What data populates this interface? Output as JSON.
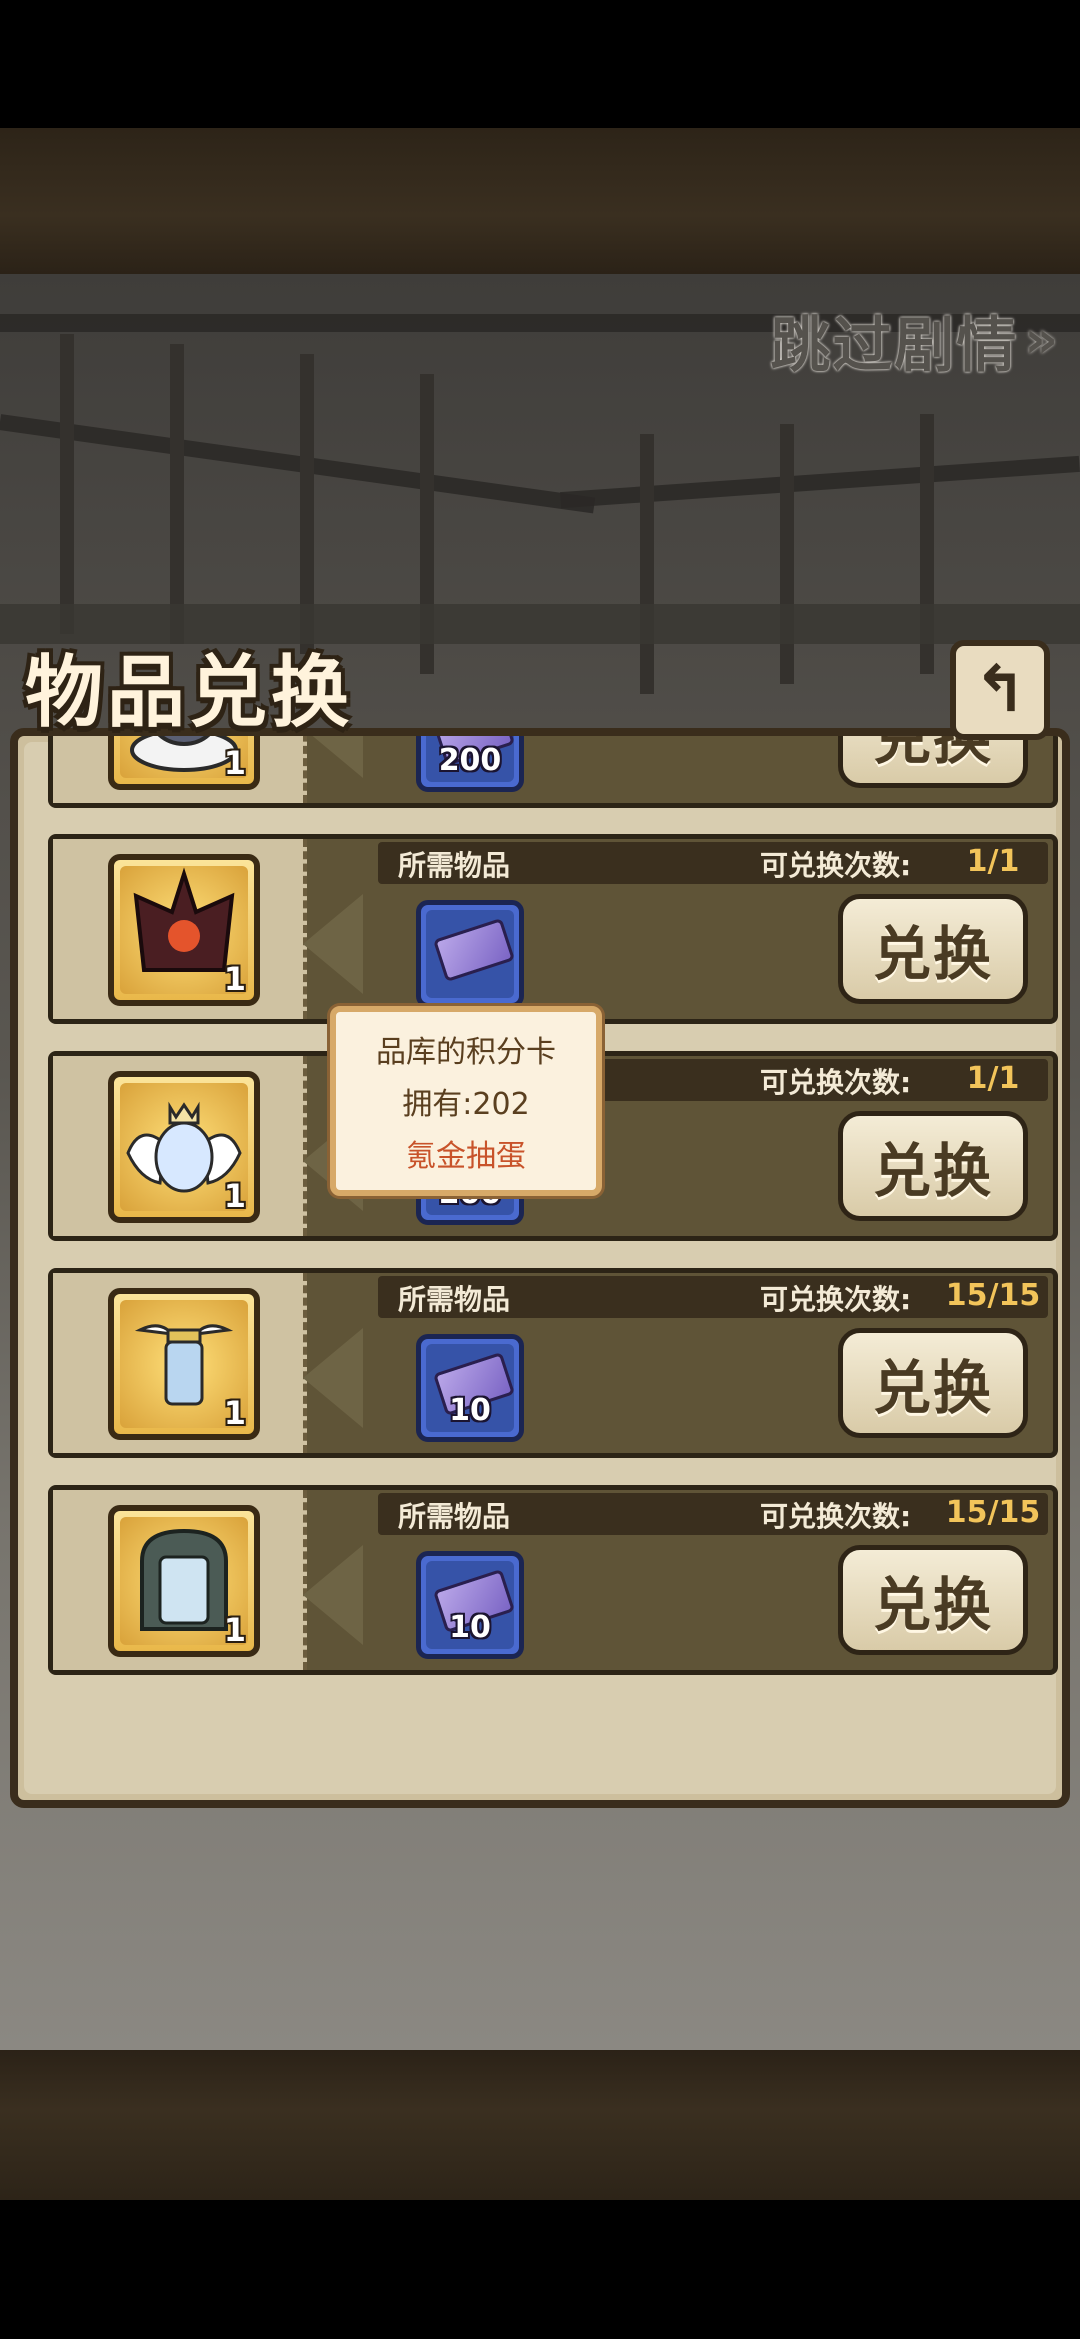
{
  "header": {
    "skip_label": "跳过剧情",
    "skip_arrow": "»"
  },
  "panel": {
    "title": "物品兑换",
    "back_icon": "↰"
  },
  "labels": {
    "required_items": "所需物品",
    "exchange_count": "可兑换次数:",
    "exchange_button": "兑换"
  },
  "rows": [
    {
      "reward_icon": "cloud-creature-icon",
      "reward_qty": "1",
      "count": "",
      "cost": "200",
      "show_header": false
    },
    {
      "reward_icon": "demon-helmet-icon",
      "reward_qty": "1",
      "count": "1/1",
      "cost": "",
      "show_header": true
    },
    {
      "reward_icon": "angel-egg-icon",
      "reward_qty": "1",
      "count": "1/1",
      "cost": "200",
      "show_header": true
    },
    {
      "reward_icon": "winged-lantern-icon",
      "reward_qty": "1",
      "count": "15/15",
      "cost": "10",
      "show_header": true
    },
    {
      "reward_icon": "mirror-gate-icon",
      "reward_qty": "1",
      "count": "15/15",
      "cost": "10",
      "show_header": true
    }
  ],
  "tooltip": {
    "name": "品库的积分卡",
    "owned": "拥有:202",
    "source": "氪金抽蛋"
  },
  "colors": {
    "accent": "#f2c45a",
    "button": "#e9dcc0",
    "cost_slot": "#4a6ad0"
  }
}
